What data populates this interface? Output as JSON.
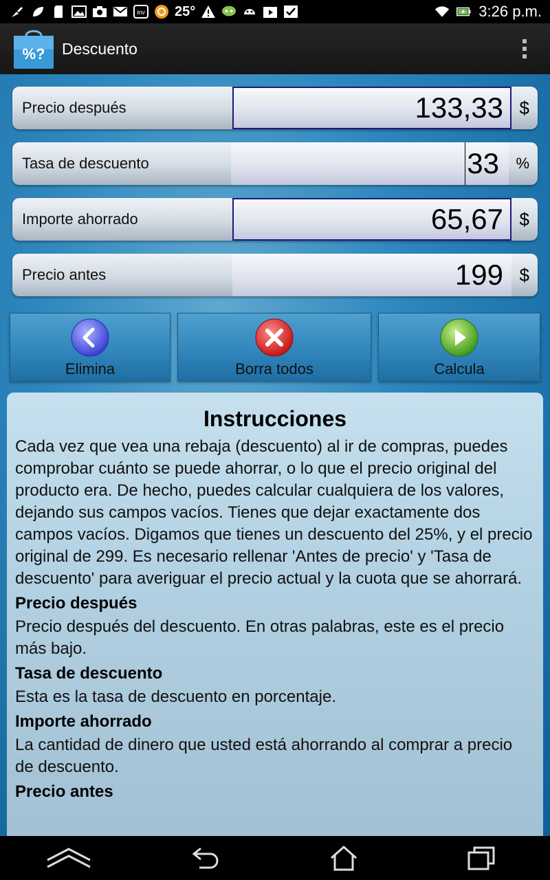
{
  "status_bar": {
    "temperature": "25°",
    "time": "3:26 p.m.",
    "icons": [
      "paint-icon",
      "leaf-icon",
      "sd-card-icon",
      "image-icon",
      "camera-icon",
      "gmail-icon",
      "inv-icon",
      "orange-app-icon",
      "warning-icon",
      "chat-icon",
      "android-icon",
      "play-store-icon",
      "check-box-icon",
      "wifi-icon",
      "battery-charging-icon"
    ]
  },
  "action_bar": {
    "title": "Descuento",
    "icon_text": "%?"
  },
  "fields": [
    {
      "label": "Precio después",
      "value": "133,33",
      "unit": "$"
    },
    {
      "label": "Tasa de descuento",
      "value": "33",
      "unit": "%"
    },
    {
      "label": "Importe ahorrado",
      "value": "65,67",
      "unit": "$"
    },
    {
      "label": "Precio antes",
      "value": "199",
      "unit": "$"
    }
  ],
  "buttons": {
    "delete": "Elimina",
    "clear_all": "Borra todos",
    "calculate": "Calcula"
  },
  "instructions": {
    "title": "Instrucciones",
    "intro": "Cada vez que vea una rebaja (descuento) al ir de compras, puedes comprobar cuánto se puede ahorrar, o lo que el precio original del producto era. De hecho, puedes calcular cualquiera de los valores, dejando sus campos vacíos. Tienes que dejar exactamente dos campos vacíos. Digamos que tienes un descuento del 25%, y el precio original de 299. Es necesario rellenar 'Antes de precio' y 'Tasa de descuento' para averiguar el precio actual y la cuota que se ahorrará.",
    "sections": [
      {
        "heading": "Precio después",
        "text": "Precio después del descuento. En otras palabras, este es el precio más bajo."
      },
      {
        "heading": "Tasa de descuento",
        "text": "Esta es la tasa de descuento en porcentaje."
      },
      {
        "heading": "Importe ahorrado",
        "text": "La cantidad de dinero que usted está ahorrando al comprar a precio de descuento."
      },
      {
        "heading": "Precio antes",
        "text": ""
      }
    ]
  },
  "colors": {
    "background": "#2d86bd",
    "focused_border": "#1a1a7a",
    "action_bar": "#1e1e1e"
  }
}
